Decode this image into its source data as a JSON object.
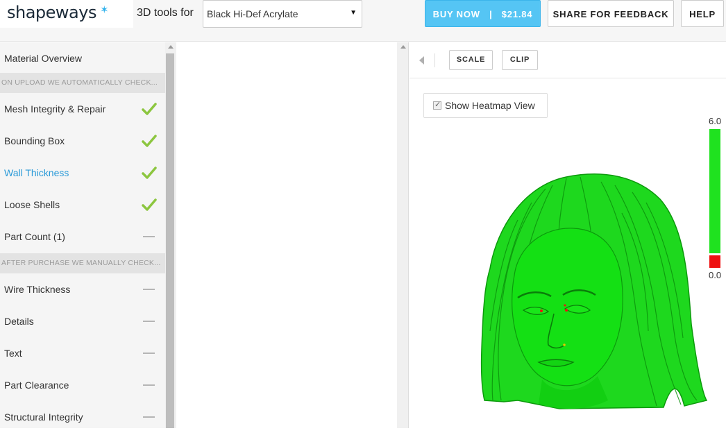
{
  "header": {
    "logo_text": "shapeways",
    "logo_star": "✶",
    "tools_label": "3D tools for",
    "material_selected": "Black Hi-Def Acrylate",
    "buy_label": "BUY NOW   |   $21.84",
    "share_label": "SHARE FOR FEEDBACK",
    "help_label": "HELP"
  },
  "sidebar": {
    "overview": "Material Overview",
    "section_upload": "ON UPLOAD WE AUTOMATICALLY CHECK...",
    "upload_items": [
      {
        "label": "Mesh Integrity & Repair",
        "status": "check"
      },
      {
        "label": "Bounding Box",
        "status": "check"
      },
      {
        "label": "Wall Thickness",
        "status": "check",
        "active": true
      },
      {
        "label": "Loose Shells",
        "status": "check"
      },
      {
        "label": "Part Count (1)",
        "status": "dash"
      }
    ],
    "section_purchase": "AFTER PURCHASE WE MANUALLY CHECK...",
    "purchase_items": [
      {
        "label": "Wire Thickness",
        "status": "dash"
      },
      {
        "label": "Details",
        "status": "dash"
      },
      {
        "label": "Text",
        "status": "dash"
      },
      {
        "label": "Part Clearance",
        "status": "dash"
      },
      {
        "label": "Structural Integrity",
        "status": "dash"
      }
    ]
  },
  "viewer": {
    "scale_label": "SCALE",
    "clip_label": "CLIP",
    "heatmap_label": "Show Heatmap View",
    "heatmap_checked": true,
    "legend_max": "6.0",
    "legend_min": "0.0"
  },
  "colors": {
    "accent": "#55c5f4",
    "check": "#8cc63f",
    "heat_ok": "#1fe21f",
    "heat_bad": "#ee1111"
  }
}
